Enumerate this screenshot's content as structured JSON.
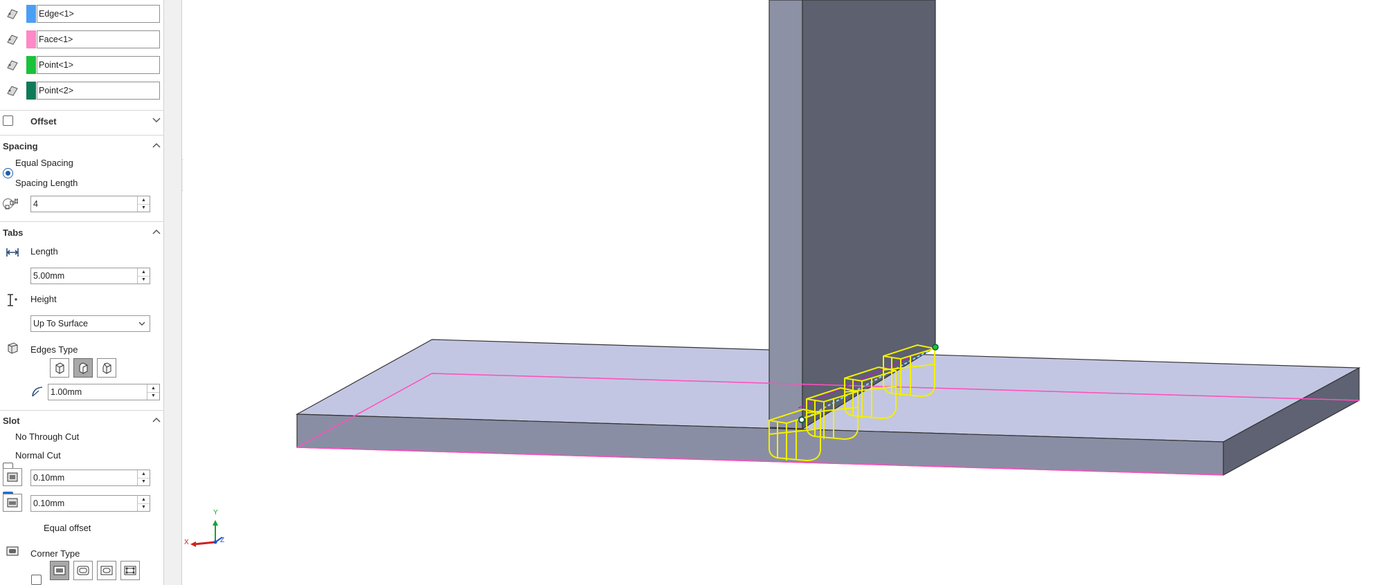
{
  "selections": {
    "items": [
      {
        "label": "Edge<1>",
        "color": "#4a9ff5"
      },
      {
        "label": "Face<1>",
        "color": "#ff88c8"
      },
      {
        "label": "Point<1>",
        "color": "#19c23a"
      },
      {
        "label": "Point<2>",
        "color": "#0f7a5a"
      }
    ]
  },
  "offset": {
    "title": "Offset",
    "checked": false
  },
  "spacing": {
    "title": "Spacing",
    "equal_label": "Equal Spacing",
    "length_label": "Spacing Length",
    "selected": "Equal Spacing",
    "count_value": "4"
  },
  "tabs": {
    "title": "Tabs",
    "length_label": "Length",
    "length_value": "5.00mm",
    "height_label": "Height",
    "height_value": "Up To Surface",
    "edges_type_label": "Edges Type",
    "edges_type_selected": 1,
    "radius_value": "1.00mm"
  },
  "slot": {
    "title": "Slot",
    "no_through_cut_label": "No Through Cut",
    "no_through_cut_checked": false,
    "normal_cut_label": "Normal Cut",
    "normal_cut_checked": true,
    "length_offset_value": "0.10mm",
    "width_offset_value": "0.10mm",
    "equal_offset_label": "Equal offset",
    "equal_offset_checked": false,
    "corner_type_label": "Corner Type",
    "corner_type_selected": 0
  },
  "triad": {
    "x": "X",
    "y": "Y",
    "z": "Z"
  },
  "colors": {
    "accent_blue": "#1e6fc9",
    "preview_yellow": "#f2f000",
    "plate_top": "#c3c6e2",
    "plate_front": "#8a8ea4",
    "post_front": "#5c606f",
    "post_side": "#8c91a5",
    "edge_magenta": "#ff4fbf"
  }
}
